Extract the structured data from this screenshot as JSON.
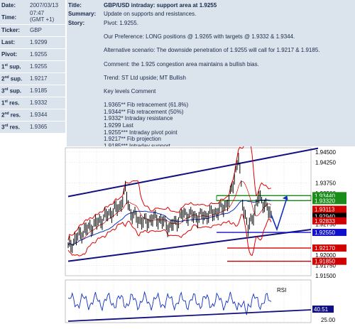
{
  "left_panel": {
    "date": {
      "label": "Date:",
      "value": "2007/03/13"
    },
    "time": {
      "label": "Time:",
      "value": "07:47",
      "value2": "(GMT +1)"
    },
    "ticker": {
      "label": "Ticker:",
      "value": "GBP"
    },
    "last": {
      "label": "Last:",
      "value": "1.9299"
    },
    "pivot": {
      "label": "Pivot:",
      "value": "1.9255"
    },
    "sup1": {
      "num": "1",
      "sup": "st",
      "label": " sup.",
      "value": "1.9255"
    },
    "sup2": {
      "num": "2",
      "sup": "nd",
      "label": " sup.",
      "value": "1.9217"
    },
    "sup3": {
      "num": "3",
      "sup": "rd",
      "label": " sup.",
      "value": "1.9185"
    },
    "res1": {
      "num": "1",
      "sup": "st",
      "label": " res.",
      "value": "1.9332"
    },
    "res2": {
      "num": "2",
      "sup": "nd",
      "label": " res.",
      "value": "1.9344"
    },
    "res3": {
      "num": "3",
      "sup": "rd",
      "label": " res.",
      "value": "1.9365"
    }
  },
  "right_panel": {
    "title_label": "Title:",
    "title_value": "GBP/USD intraday: support area at 1.9255",
    "summary_label": "Summary:",
    "summary_value": "Update on supports and resistances.",
    "story_label": "Story:",
    "story_lines": [
      "Pivot: 1.9255.",
      "",
      "Our Preference: LONG positions @ 1.9265 with targets @ 1.9332 & 1.9344.",
      "",
      "Alternative scenario: The downside penetration of 1.9255 will call for 1.9217 & 1.9185.",
      "",
      "Comment: the 1.925 congestion area maintains a bullish bias.",
      "",
      "Trend: ST Ltd upside; MT Bullish",
      "",
      "Key levels Comment",
      "",
      "1.9365** Fib retracement (61.8%)",
      "1.9344** Fib retracement (50%)",
      "1.9332* Intraday resistance",
      "1.9299 Last",
      "1.9255*** Intraday pivot point",
      "1.9217** Fib projection",
      "1.9185*** Intraday support"
    ]
  },
  "chart_data": {
    "type": "line",
    "title": "",
    "price_axis_ticks": [
      "1.94500",
      "1.94250",
      "1.93750",
      "1.93500",
      "1.93000",
      "1.92750",
      "1.92000",
      "1.91750",
      "1.91500"
    ],
    "price_ylim": [
      1.915,
      1.946
    ],
    "price_tags": [
      {
        "label": "1.93440",
        "value": 1.9344,
        "color": "#1a8c1a"
      },
      {
        "label": "1.93320",
        "value": 1.9332,
        "color": "#1a8c1a"
      },
      {
        "label": "1.93113",
        "value": 1.9311,
        "color": "#d00000"
      },
      {
        "label": "1.92940",
        "value": 1.9294,
        "color": "#000000"
      },
      {
        "label": "1.92833",
        "value": 1.9283,
        "color": "#d00000"
      },
      {
        "label": "1.92550",
        "value": 1.9255,
        "color": "#1010cc"
      },
      {
        "label": "1.92170",
        "value": 1.9217,
        "color": "#d00000"
      },
      {
        "label": "1.91850",
        "value": 1.9185,
        "color": "#d00000"
      }
    ],
    "rsi_label": "RSI",
    "rsi_ticks": [
      "25.00"
    ],
    "rsi_value_label": "40.51",
    "colors": {
      "price": "#000000",
      "bands": "#e00000",
      "ma": "#1030c0",
      "channel": "#101080",
      "resistance": "#1a8c1a",
      "support": "#d00000"
    }
  }
}
